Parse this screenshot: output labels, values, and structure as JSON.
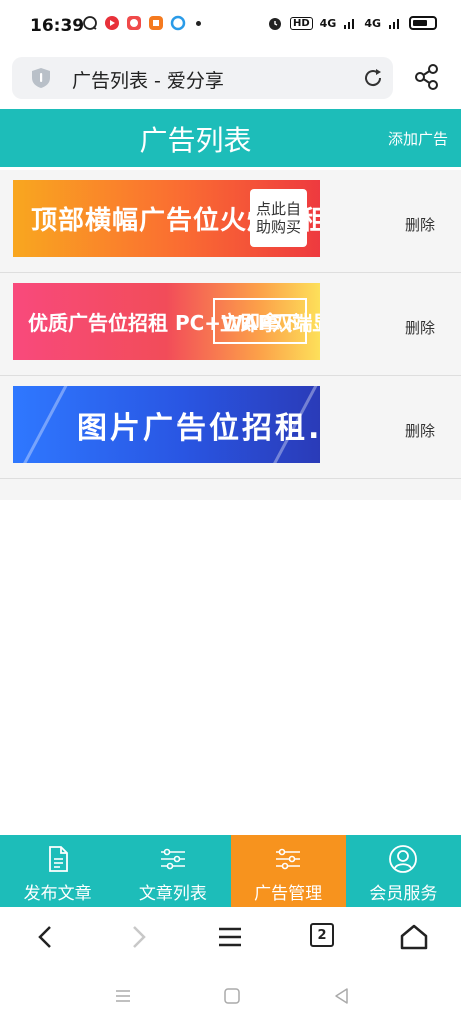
{
  "status": {
    "time": "16:39",
    "network_1": "4G",
    "network_2": "4G",
    "hd": "HD"
  },
  "browser": {
    "url_title": "广告列表 - 爱分享",
    "tab_count": "2"
  },
  "header": {
    "title": "广告列表",
    "add_label": "添加广告"
  },
  "ads": [
    {
      "text": "顶部横幅广告位火爆招租中……",
      "cta": "点此自助购买",
      "delete_label": "删除"
    },
    {
      "text": "优质广告位招租  PC+WAP双端显示",
      "cta": "立即拿下",
      "delete_label": "删除"
    },
    {
      "text": "图片广告位招租...",
      "cta": "",
      "delete_label": "删除"
    }
  ],
  "tabs": [
    {
      "label": "发布文章",
      "icon": "document-icon",
      "active": false
    },
    {
      "label": "文章列表",
      "icon": "list-icon",
      "active": false
    },
    {
      "label": "广告管理",
      "icon": "list-icon",
      "active": true
    },
    {
      "label": "会员服务",
      "icon": "user-icon",
      "active": false
    }
  ],
  "colors": {
    "primary": "#1dbdb9",
    "active_tab": "#f7931e"
  }
}
